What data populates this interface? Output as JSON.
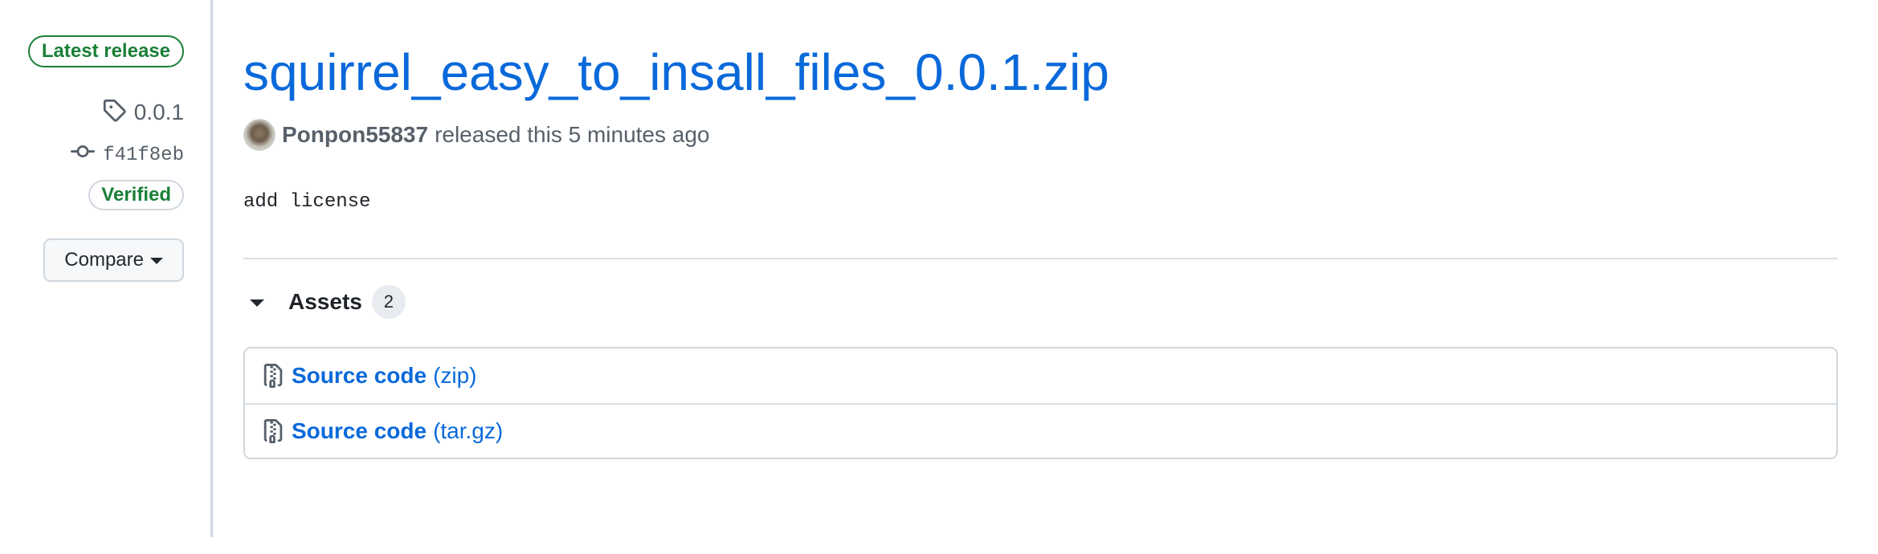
{
  "sidebar": {
    "latest_badge": "Latest release",
    "tag": "0.0.1",
    "commit": "f41f8eb",
    "verified_badge": "Verified",
    "compare_label": "Compare"
  },
  "release": {
    "title": "squirrel_easy_to_insall_files_0.0.1.zip",
    "author": "Ponpon55837",
    "released_text": "released this 5 minutes ago",
    "body": "add license"
  },
  "assets": {
    "label": "Assets",
    "count": "2",
    "items": [
      {
        "name": "Source code",
        "ext": "(zip)"
      },
      {
        "name": "Source code",
        "ext": "(tar.gz)"
      }
    ]
  },
  "colors": {
    "link": "#0969da",
    "success": "#1a7f37",
    "border": "#d0d7de",
    "muted": "#57606a"
  },
  "icons": {
    "tag": "tag-icon",
    "commit": "git-commit-icon",
    "caret": "triangle-down-icon",
    "archive": "file-zip-icon"
  }
}
